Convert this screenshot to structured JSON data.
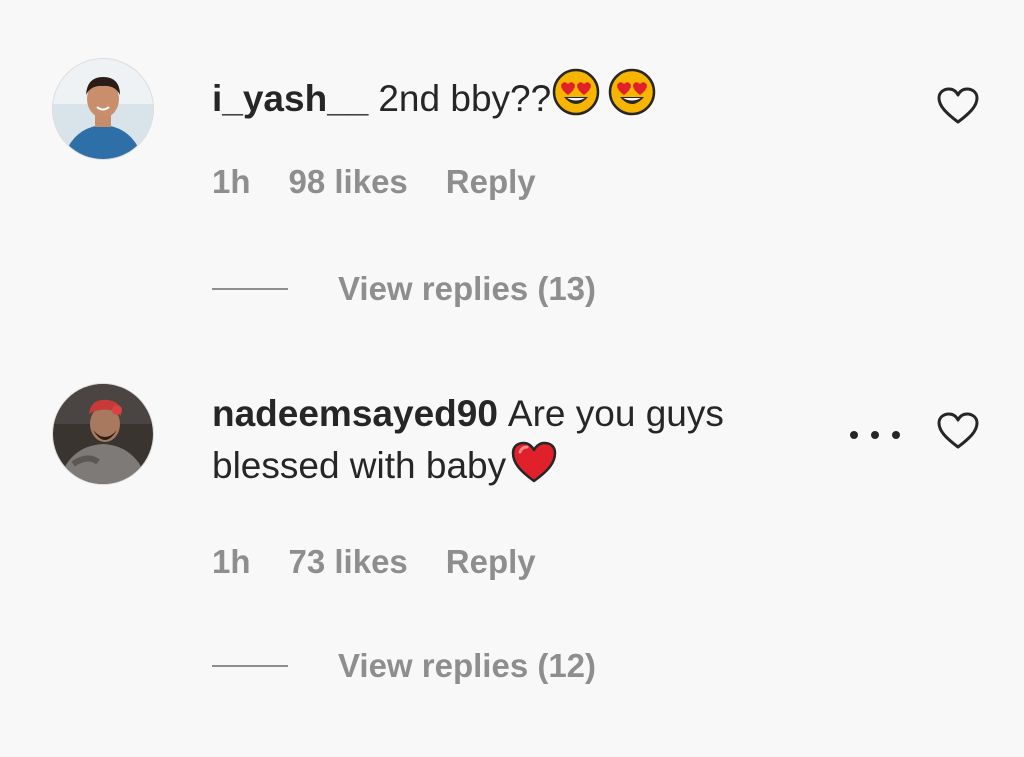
{
  "comments": [
    {
      "username": "i_yash__",
      "text": "2nd bby??",
      "emojis": [
        "heart-eyes-emoji",
        "heart-eyes-emoji"
      ],
      "time": "1h",
      "likes": "98 likes",
      "reply_label": "Reply",
      "view_replies": "View replies (13)"
    },
    {
      "username": "nadeemsayed90",
      "text": "Are you guys blessed with baby",
      "emojis": [
        "red-heart-emoji"
      ],
      "time": "1h",
      "likes": "73 likes",
      "reply_label": "Reply",
      "view_replies": "View replies (12)"
    }
  ],
  "colors": {
    "background": "#f8f8f9",
    "primary_text": "#262626",
    "secondary_text": "#8e8e8e",
    "emoji_yellow": "#f7b500",
    "emoji_heart_red": "#e0202b"
  },
  "icons": {
    "like": "heart-outline-icon",
    "more": "more-options-icon"
  }
}
